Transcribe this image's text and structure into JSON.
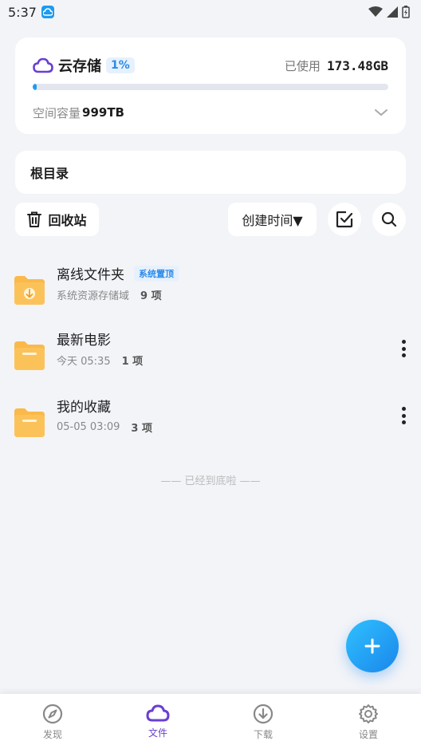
{
  "status": {
    "time": "5:37"
  },
  "storage": {
    "title": "云存储",
    "percent": "1%",
    "used_label": "已使用",
    "used_value": "173.48GB",
    "usage_fraction": 0.01,
    "capacity_label": "空间容量",
    "capacity_value": "999TB"
  },
  "root": {
    "title": "根目录"
  },
  "toolbar": {
    "recycle_label": "回收站",
    "sort_label": "创建时间▼"
  },
  "files": [
    {
      "name": "离线文件夹",
      "badge": "系统置顶",
      "sub": "系统资源存储域",
      "count": "9 项",
      "icon": "download-folder-icon"
    },
    {
      "name": "最新电影",
      "sub": "今天 05:35",
      "count": "1 项",
      "icon": "folder-icon"
    },
    {
      "name": "我的收藏",
      "sub": "05-05 03:09",
      "count": "3 项",
      "icon": "folder-icon"
    }
  ],
  "end_text": "—— 已经到底啦 ——",
  "nav": [
    {
      "label": "发现",
      "icon": "compass-icon"
    },
    {
      "label": "文件",
      "icon": "cloud-icon",
      "active": true
    },
    {
      "label": "下载",
      "icon": "download-icon"
    },
    {
      "label": "设置",
      "icon": "gear-icon"
    }
  ],
  "colors": {
    "accent": "#1e9bf0",
    "brand_purple": "#6a3fd1",
    "folder": "#fbb949"
  }
}
